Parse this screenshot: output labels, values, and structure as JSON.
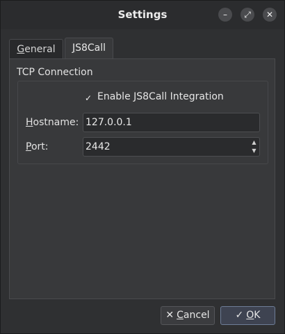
{
  "window": {
    "title": "Settings",
    "controls": [
      "minimize-icon",
      "restore-icon",
      "close-icon"
    ]
  },
  "tabs": [
    {
      "label_pre": "",
      "label_u": "G",
      "label_post": "eneral",
      "active": false
    },
    {
      "label_pre": "",
      "label_u": "J",
      "label_post": "S8Call",
      "active": true
    }
  ],
  "group": {
    "title": "TCP Connection",
    "enable_checkbox": {
      "label": "Enable JS8Call Integration",
      "checked": true
    },
    "hostname": {
      "label_u": "H",
      "label_rest": "ostname:",
      "value": "127.0.0.1"
    },
    "port": {
      "label_u": "P",
      "label_rest": "ort:",
      "value": "2442"
    }
  },
  "buttons": {
    "cancel": {
      "label_u": "C",
      "label_rest": "ancel",
      "icon": "close-icon"
    },
    "ok": {
      "label_u": "O",
      "label_rest": "K",
      "icon": "check-icon"
    }
  },
  "colors": {
    "accent": "#6e7d97",
    "background": "#2f3032"
  }
}
